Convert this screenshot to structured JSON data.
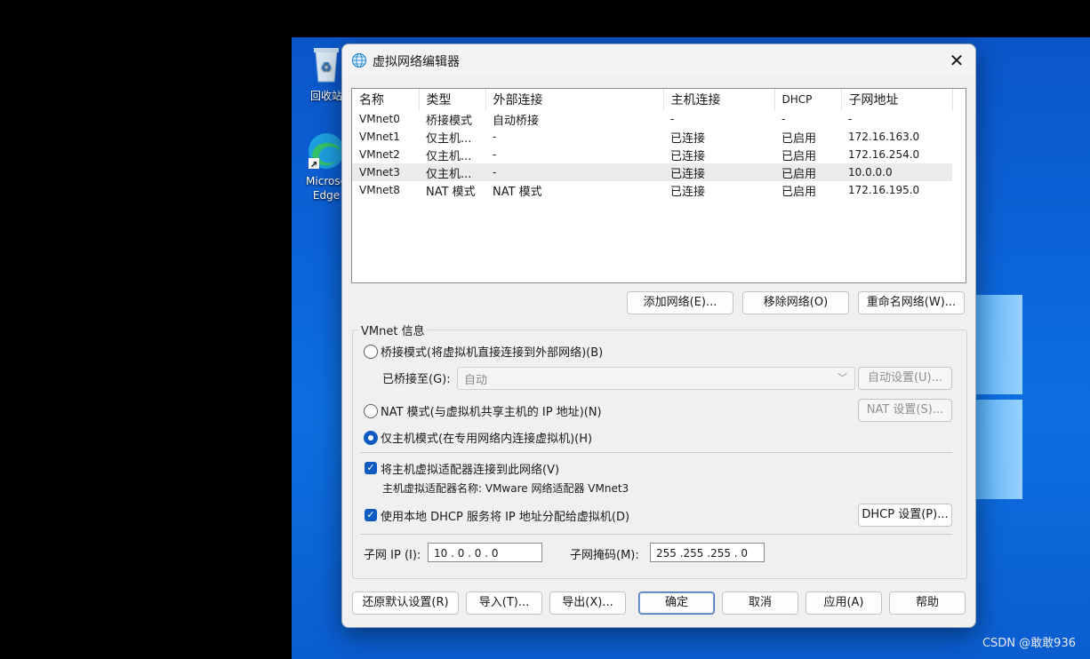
{
  "desktop": {
    "icons": [
      {
        "label": "回收站"
      },
      {
        "label": "Microsoft Edge",
        "label_line1": "Microso",
        "label_line2": "Edge"
      }
    ],
    "watermark": "CSDN @敢敢936"
  },
  "dialog": {
    "title": "虚拟网络编辑器",
    "close_glyph": "✕",
    "columns": [
      "名称",
      "类型",
      "外部连接",
      "主机连接",
      "DHCP",
      "子网地址"
    ],
    "rows": [
      [
        "VMnet0",
        "桥接模式",
        "自动桥接",
        "-",
        "-",
        "-"
      ],
      [
        "VMnet1",
        "仅主机...",
        "-",
        "已连接",
        "已启用",
        "172.16.163.0"
      ],
      [
        "VMnet2",
        "仅主机...",
        "-",
        "已连接",
        "已启用",
        "172.16.254.0"
      ],
      [
        "VMnet3",
        "仅主机...",
        "-",
        "已连接",
        "已启用",
        "10.0.0.0"
      ],
      [
        "VMnet8",
        "NAT 模式",
        "NAT 模式",
        "已连接",
        "已启用",
        "172.16.195.0"
      ]
    ],
    "selected_row": "VMnet3",
    "list_buttons": {
      "add": "添加网络(E)...",
      "remove": "移除网络(O)",
      "rename": "重命名网络(W)..."
    },
    "vmnet_info": {
      "group_label": "VMnet 信息",
      "bridged_label": "桥接模式(将虚拟机直接连接到外部网络)(B)",
      "bridged_to_label": "已桥接至(G):",
      "bridged_to_value": "自动",
      "auto_settings": "自动设置(U)...",
      "nat_label": "NAT 模式(与虚拟机共享主机的 IP 地址)(N)",
      "nat_settings": "NAT 设置(S)...",
      "hostonly_label": "仅主机模式(在专用网络内连接虚拟机)(H)",
      "mode_selected": "hostonly",
      "connect_adapter_label": "将主机虚拟适配器连接到此网络(V)",
      "connect_adapter_checked": true,
      "adapter_name_label": "主机虚拟适配器名称: VMware 网络适配器 VMnet3",
      "dhcp_label": "使用本地 DHCP 服务将 IP 地址分配给虚拟机(D)",
      "dhcp_checked": true,
      "dhcp_settings": "DHCP 设置(P)...",
      "subnet_ip_label": "子网 IP (I):",
      "subnet_ip_value": "10 . 0 . 0 . 0",
      "subnet_mask_label": "子网掩码(M):",
      "subnet_mask_value": "255 .255 .255 . 0"
    },
    "footer": {
      "restore": "还原默认设置(R)",
      "import": "导入(T)...",
      "export": "导出(X)...",
      "ok": "确定",
      "cancel": "取消",
      "apply": "应用(A)",
      "help": "帮助"
    },
    "colors": {
      "accent": "#0f5bc1",
      "desktop_blue": "#0b63d8"
    }
  }
}
